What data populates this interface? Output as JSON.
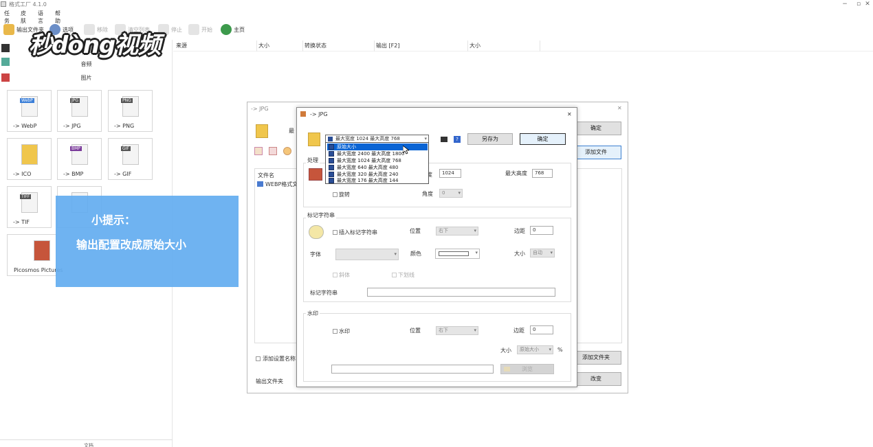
{
  "window": {
    "title": "格式工厂 4.1.0",
    "controls": [
      "−",
      "▫",
      "✕"
    ]
  },
  "menu": [
    "任务",
    "皮肤",
    "语言",
    "帮助"
  ],
  "toolbar": {
    "output_folder": "输出文件夹",
    "options": "选项",
    "remove": "移除",
    "clear_list": "清空列表",
    "stop": "停止",
    "start": "开始",
    "home": "主页"
  },
  "left_panel": {
    "audio_label": "音频",
    "image_label": "图片",
    "tiles": [
      {
        "tag": "WebP",
        "label": "-> WebP"
      },
      {
        "tag": "JPG",
        "label": "-> JPG"
      },
      {
        "tag": "PNG",
        "label": "-> PNG"
      },
      {
        "tag": "",
        "label": "-> ICO"
      },
      {
        "tag": "BMP",
        "label": "-> BMP"
      },
      {
        "tag": "GIF",
        "label": "-> GIF"
      },
      {
        "tag": "TIFF",
        "label": "-> TIF"
      },
      {
        "tag": "",
        "label": ""
      },
      {
        "tag": "",
        "label": "Picosmos Pictures"
      }
    ],
    "bottom_label": "文档"
  },
  "columns": [
    "来源",
    "大小",
    "转换状态",
    "输出 [F2]",
    "大小"
  ],
  "watermark": "秒dòng视频",
  "tip": {
    "title": "小提示：",
    "body": "输出配置改成原始大小"
  },
  "back_dialog": {
    "title": "-> JPG",
    "ok": "确定",
    "output_label": "最",
    "add_file": "添加文件",
    "file_column": "文件名",
    "file_row": "WEBP格式文件",
    "add_setting_name": "添加设置名称",
    "add_folder": "添加文件夹",
    "output_folder": "输出文件夹",
    "change": "改变"
  },
  "front_dialog": {
    "title": "-> JPG",
    "close": "✕",
    "selected_profile": "最大宽度 1024 最大高度 768",
    "save_as": "另存为",
    "ok": "确定",
    "processing": {
      "title": "处理",
      "width_label": "度",
      "width_value": "1024",
      "height_label": "最大高度",
      "height_value": "768",
      "rotate": "旋转",
      "angle_label": "角度",
      "angle_value": "0"
    },
    "text_mark": {
      "title": "标记字符串",
      "insert": "插入标记字符串",
      "position_label": "位置",
      "position_value": "右下",
      "margin_label": "边距",
      "margin_value": "0",
      "font_label": "字体",
      "font_value": "",
      "color_label": "颜色",
      "size_label": "大小",
      "size_value": "自动",
      "italic": "斜体",
      "underline": "下划线",
      "string_label": "标记字符串",
      "string_value": ""
    },
    "watermark": {
      "title": "水印",
      "enable": "水印",
      "position_label": "位置",
      "position_value": "右下",
      "margin_label": "边距",
      "margin_value": "0",
      "size_label": "大小",
      "size_value": "原始大小",
      "percent": "%",
      "path_value": "",
      "browse": "浏览"
    }
  },
  "dropdown": [
    "原始大小",
    "最大宽度 2400 最大高度 1800",
    "最大宽度 1024 最大高度 768",
    "最大宽度 640 最大高度 480",
    "最大宽度 320 最大高度 240",
    "最大宽度 176 最大高度 144"
  ],
  "colors": {
    "tip_bg": "#63adf0",
    "selection": "#0a64d4",
    "accent_border": "#3c7fd0"
  }
}
